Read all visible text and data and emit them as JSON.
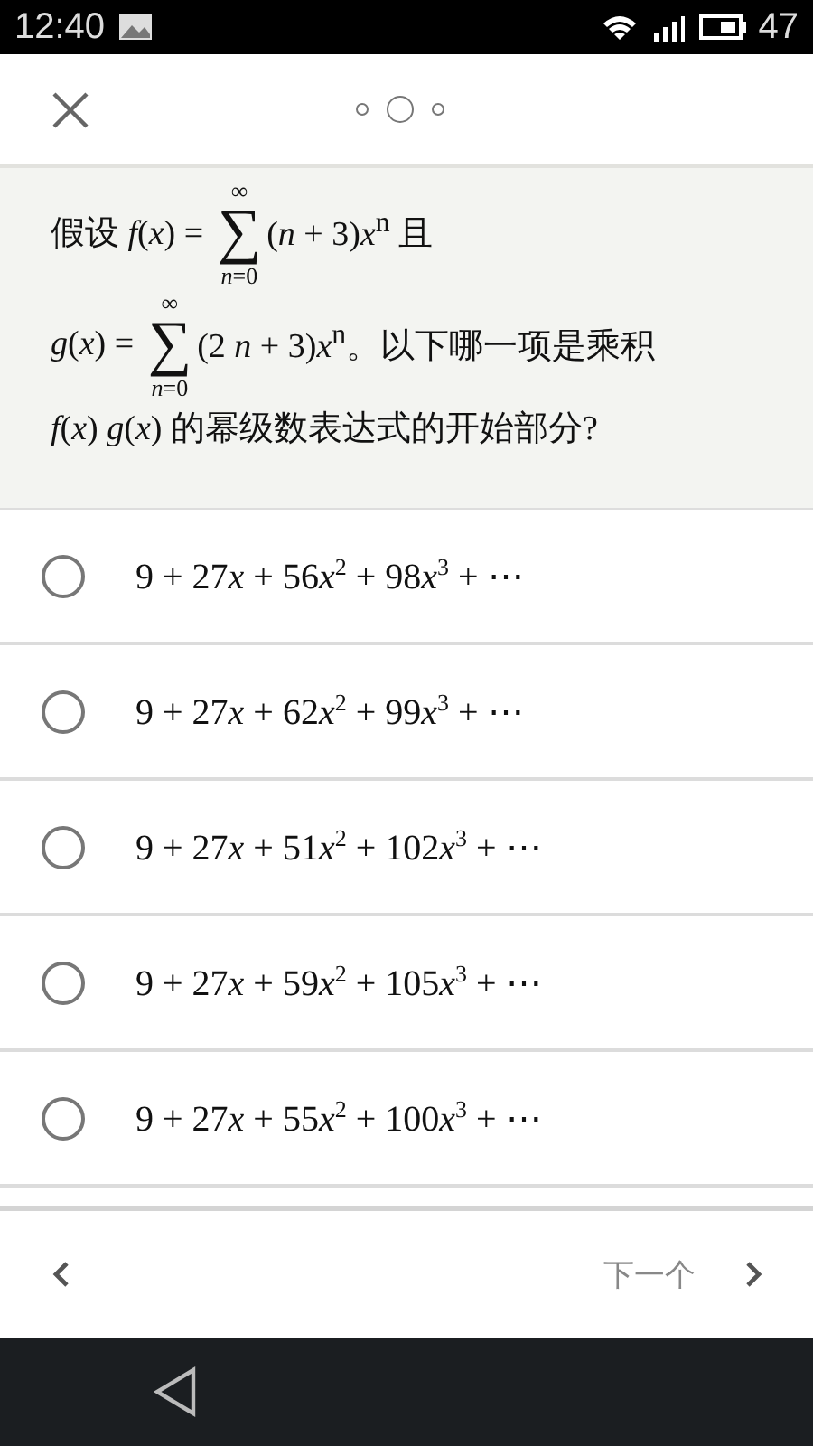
{
  "status_bar": {
    "time": "12:40",
    "battery": "47"
  },
  "header": {
    "pages": [
      {
        "selected": false
      },
      {
        "selected": true
      },
      {
        "selected": false
      }
    ]
  },
  "question": {
    "lines": [
      [
        {
          "kind": "text",
          "text": "假设 *f*(*x*) = "
        },
        {
          "kind": "sum",
          "symbol": "∑",
          "upper": "∞",
          "lower": "*n*=0"
        },
        {
          "kind": "text",
          "text": "(*n* + 3)*x*$^{n}$ 且"
        }
      ],
      [
        {
          "kind": "text",
          "text": "*g*(*x*) = "
        },
        {
          "kind": "sum",
          "symbol": "∑",
          "upper": "∞",
          "lower": "*n*=0"
        },
        {
          "kind": "text",
          "text": "(2 *n* + 3)*x*$^{n}$。以下哪一项是乘积"
        }
      ],
      [
        {
          "kind": "text",
          "text": "*f*(*x*) *g*(*x*) 的幂级数表达式的开始部分?"
        }
      ]
    ]
  },
  "options": [
    {
      "parts": [
        {
          "kind": "num",
          "text": "9 + 27"
        },
        {
          "kind": "var",
          "text": "x"
        },
        {
          "kind": "num",
          "text": " + 56"
        },
        {
          "kind": "var",
          "text": "x"
        },
        {
          "kind": "sup",
          "text": "2"
        },
        {
          "kind": "num",
          "text": " + 98"
        },
        {
          "kind": "var",
          "text": "x"
        },
        {
          "kind": "sup",
          "text": "3"
        },
        {
          "kind": "num",
          "text": " + ⋯"
        }
      ],
      "selected": false
    },
    {
      "parts": [
        {
          "kind": "num",
          "text": "9 + 27"
        },
        {
          "kind": "var",
          "text": "x"
        },
        {
          "kind": "num",
          "text": " + 62"
        },
        {
          "kind": "var",
          "text": "x"
        },
        {
          "kind": "sup",
          "text": "2"
        },
        {
          "kind": "num",
          "text": " + 99"
        },
        {
          "kind": "var",
          "text": "x"
        },
        {
          "kind": "sup",
          "text": "3"
        },
        {
          "kind": "num",
          "text": " + ⋯"
        }
      ],
      "selected": false
    },
    {
      "parts": [
        {
          "kind": "num",
          "text": "9 + 27"
        },
        {
          "kind": "var",
          "text": "x"
        },
        {
          "kind": "num",
          "text": " + 51"
        },
        {
          "kind": "var",
          "text": "x"
        },
        {
          "kind": "sup",
          "text": "2"
        },
        {
          "kind": "num",
          "text": " + 102"
        },
        {
          "kind": "var",
          "text": "x"
        },
        {
          "kind": "sup",
          "text": "3"
        },
        {
          "kind": "num",
          "text": " + ⋯"
        }
      ],
      "selected": false
    },
    {
      "parts": [
        {
          "kind": "num",
          "text": "9 + 27"
        },
        {
          "kind": "var",
          "text": "x"
        },
        {
          "kind": "num",
          "text": " + 59"
        },
        {
          "kind": "var",
          "text": "x"
        },
        {
          "kind": "sup",
          "text": "2"
        },
        {
          "kind": "num",
          "text": " + 105"
        },
        {
          "kind": "var",
          "text": "x"
        },
        {
          "kind": "sup",
          "text": "3"
        },
        {
          "kind": "num",
          "text": " + ⋯"
        }
      ],
      "selected": false
    },
    {
      "parts": [
        {
          "kind": "num",
          "text": "9 + 27"
        },
        {
          "kind": "var",
          "text": "x"
        },
        {
          "kind": "num",
          "text": " + 55"
        },
        {
          "kind": "var",
          "text": "x"
        },
        {
          "kind": "sup",
          "text": "2"
        },
        {
          "kind": "num",
          "text": " + 100"
        },
        {
          "kind": "var",
          "text": "x"
        },
        {
          "kind": "sup",
          "text": "3"
        },
        {
          "kind": "num",
          "text": " + ⋯"
        }
      ],
      "selected": false
    }
  ],
  "footer": {
    "next_label": "下一个"
  }
}
